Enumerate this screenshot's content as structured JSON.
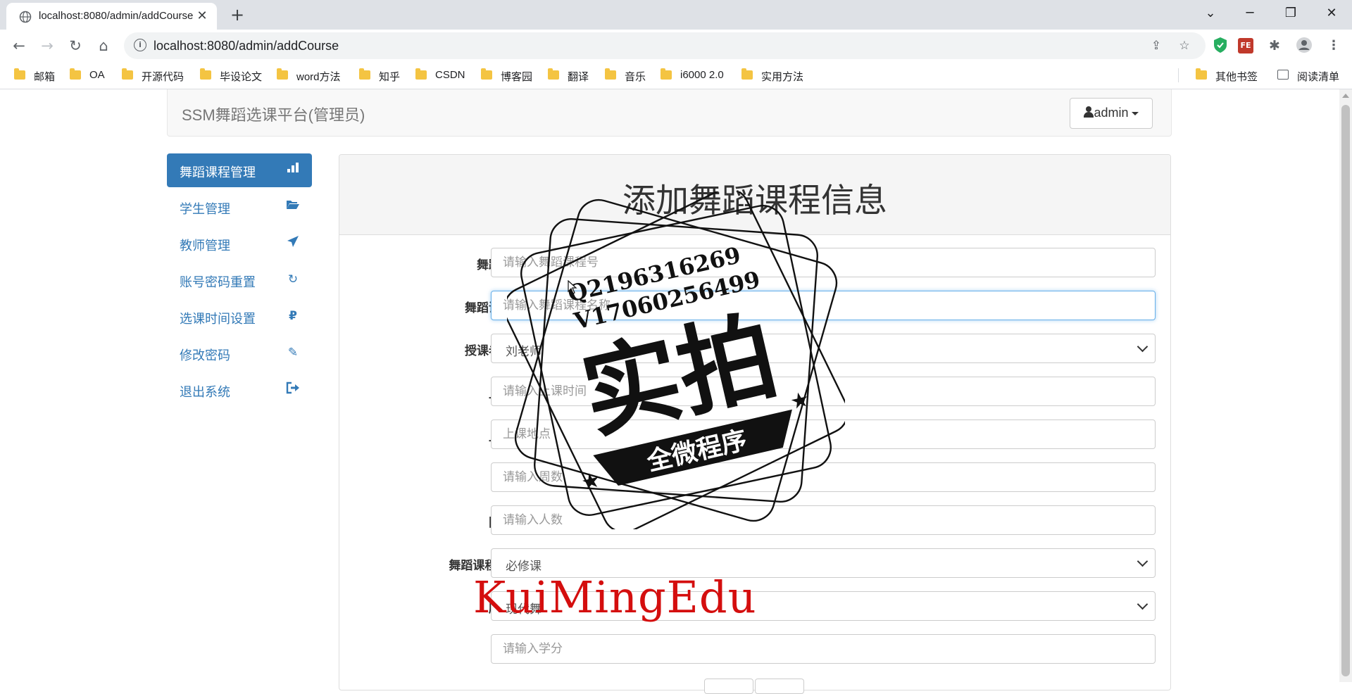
{
  "browser": {
    "tab_title": "localhost:8080/admin/addCourse",
    "new_tab": "+",
    "url": "localhost:8080/admin/addCourse",
    "bookmarks": [
      "邮箱",
      "OA",
      "开源代码",
      "毕设论文",
      "word方法",
      "知乎",
      "CSDN",
      "博客园",
      "翻译",
      "音乐",
      "i6000 2.0",
      "实用方法"
    ],
    "other_bookmarks": "其他书签",
    "reading_list": "阅读清单",
    "extension_fe": "FE"
  },
  "navbar": {
    "brand": "SSM舞蹈选课平台(管理员)",
    "user": "admin"
  },
  "sidebar": {
    "items": [
      {
        "label": "舞蹈课程管理",
        "icon": "bar-chart-icon",
        "active": true
      },
      {
        "label": "学生管理",
        "icon": "folder-open-icon",
        "active": false
      },
      {
        "label": "教师管理",
        "icon": "send-icon",
        "active": false
      },
      {
        "label": "账号密码重置",
        "icon": "refresh-icon",
        "active": false
      },
      {
        "label": "选课时间设置",
        "icon": "ruble-icon",
        "active": false
      },
      {
        "label": "修改密码",
        "icon": "pencil-icon",
        "active": false
      },
      {
        "label": "退出系统",
        "icon": "logout-icon",
        "active": false
      }
    ]
  },
  "panel": {
    "title": "添加舞蹈课程信息"
  },
  "form": {
    "course_no": {
      "label": "舞蹈课程号",
      "placeholder": "请输入舞蹈课程号"
    },
    "course_name": {
      "label": "舞蹈课程名称",
      "placeholder": "请输入舞蹈课程名称"
    },
    "teacher_id": {
      "label": "授课老师编号",
      "value": "刘老师"
    },
    "class_time": {
      "label": "上课时间",
      "placeholder": "请输入上课时间"
    },
    "class_place": {
      "label": "上课地点",
      "placeholder": "上课地点"
    },
    "weeks": {
      "label": "周数",
      "placeholder": "请输入周数"
    },
    "limit": {
      "label": "限制人数",
      "placeholder": "请输入人数"
    },
    "course_type": {
      "label": "舞蹈课程的类型:",
      "value": "必修课"
    },
    "dance_type": {
      "label": "所属舞种",
      "value": "现代舞"
    },
    "credit": {
      "label": "学分:",
      "placeholder": "请输入学分"
    }
  },
  "stamp": {
    "qq": "Q2196316269",
    "wechat": "V17060256499",
    "main": "实拍",
    "sub": "全微程序"
  },
  "watermark": "KuiMingEdu",
  "colors": {
    "primary": "#337ab7",
    "watermark": "#d40e0e",
    "navbar_bg": "#f8f8f8",
    "chrome_tab_bg": "#dee1e6"
  }
}
